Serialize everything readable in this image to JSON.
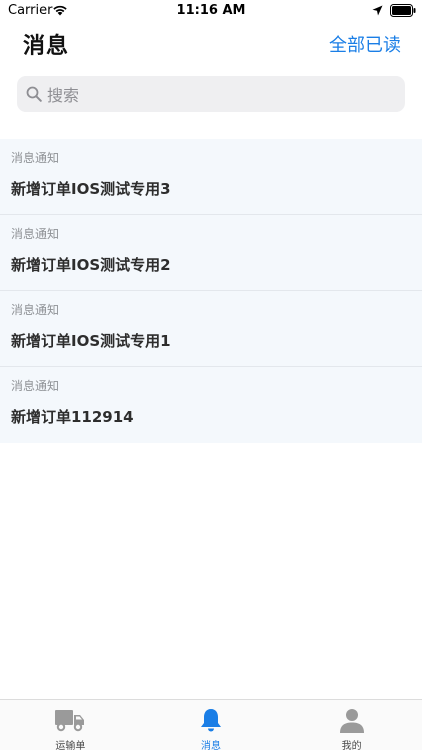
{
  "status_bar": {
    "carrier": "Carrier",
    "time": "11:16 AM"
  },
  "header": {
    "title": "消息",
    "mark_all_read": "全部已读"
  },
  "search": {
    "placeholder": "搜索"
  },
  "messages": [
    {
      "category": "消息通知",
      "title": "新增订单IOS测试专用3"
    },
    {
      "category": "消息通知",
      "title": "新增订单IOS测试专用2"
    },
    {
      "category": "消息通知",
      "title": "新增订单IOS测试专用1"
    },
    {
      "category": "消息通知",
      "title": "新增订单112914"
    }
  ],
  "tab_bar": {
    "tabs": [
      {
        "label": "运输单",
        "icon": "truck-icon",
        "active": false
      },
      {
        "label": "消息",
        "icon": "bell-icon",
        "active": true
      },
      {
        "label": "我的",
        "icon": "person-icon",
        "active": false
      }
    ]
  },
  "colors": {
    "accent": "#1a7ee6",
    "list_background": "#f4f8fc",
    "search_background": "#efeff1"
  }
}
